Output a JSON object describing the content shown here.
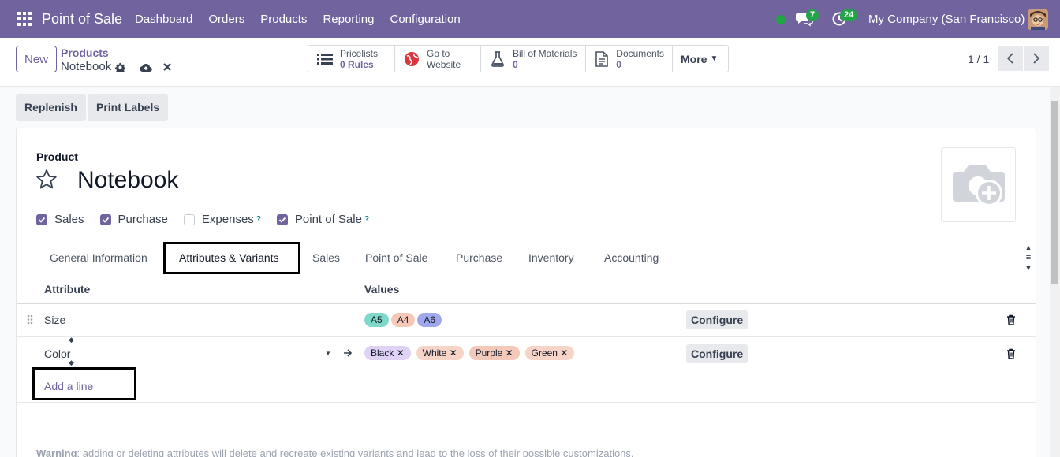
{
  "navbar": {
    "brand": "Point of Sale",
    "menu": [
      "Dashboard",
      "Orders",
      "Products",
      "Reporting",
      "Configuration"
    ],
    "chat_count": "7",
    "activity_count": "24",
    "company": "My Company (San Francisco)"
  },
  "control": {
    "new_label": "New",
    "breadcrumb_parent": "Products",
    "breadcrumb_current": "Notebook",
    "smart_buttons": [
      {
        "line1": "Pricelists",
        "line2": "0 Rules"
      },
      {
        "line1": "Go to",
        "line2": "Website"
      },
      {
        "line1": "Bill of Materials",
        "line2": "0"
      },
      {
        "line1": "Documents",
        "line2": "0"
      }
    ],
    "more_label": "More",
    "pager": "1 / 1"
  },
  "actions": {
    "replenish": "Replenish",
    "print_labels": "Print Labels"
  },
  "form": {
    "product_label": "Product",
    "product_name": "Notebook",
    "checkboxes": [
      {
        "label": "Sales",
        "checked": true,
        "help": ""
      },
      {
        "label": "Purchase",
        "checked": true,
        "help": ""
      },
      {
        "label": "Expenses",
        "checked": false,
        "help": "?"
      },
      {
        "label": "Point of Sale",
        "checked": true,
        "help": "?"
      }
    ],
    "tabs": [
      "General Information",
      "Attributes & Variants",
      "Sales",
      "Point of Sale",
      "Purchase",
      "Inventory",
      "Accounting"
    ],
    "active_tab": "Attributes & Variants"
  },
  "table": {
    "headers": {
      "attribute": "Attribute",
      "values": "Values"
    },
    "rows": [
      {
        "attribute": "Size",
        "values": [
          "A5",
          "A4",
          "A6"
        ],
        "configure": "Configure"
      },
      {
        "attribute": "Color",
        "values": [
          "Black",
          "White",
          "Purple",
          "Green"
        ],
        "configure": "Configure"
      }
    ],
    "add_line": "Add a line",
    "warning_bold": "Warning",
    "warning_text": ": adding or deleting attributes will delete and recreate existing variants and lead to the loss of their possible customizations."
  },
  "colors": {
    "brand": "#71639e",
    "success": "#22a447"
  }
}
